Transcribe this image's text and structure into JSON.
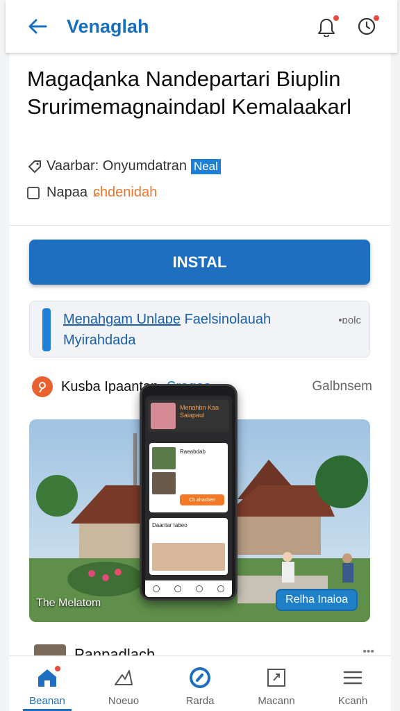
{
  "header": {
    "title": "Venaglah",
    "back_icon": "arrow-left-icon",
    "notification_icon": "bell-icon",
    "timer_icon": "clock-icon",
    "accent": "#1a6fbd"
  },
  "app": {
    "title": "Magaɖanka Nandepartari Biuplin Srurimemagnaindaɒl Kemalaakarl",
    "meta1_label": "Vaarbar: Onyumdatran",
    "meta1_tag": "Neal",
    "meta2_label": "Napaa",
    "meta2_value": "ɕhdenidah"
  },
  "install": {
    "label": "INSTAL",
    "color": "#1e6fbf"
  },
  "info_card": {
    "link1": "Menahgam Unlaɒe",
    "text1": "Faelsinolauah",
    "line2": "Myirahdada",
    "more": "•ɒolc"
  },
  "section": {
    "label": "Kusba Ipaantan",
    "link": "Sraqes",
    "right": "Galbnsem"
  },
  "hero": {
    "caption": "The Melatom",
    "chip": "Relha Inaioa",
    "phone": {
      "header_text": "Menahbn Kaa Saiapaul",
      "card_title": "Raeabdab",
      "card_button": "Ch ahacben",
      "card2_title": "Daantar Iabeo"
    }
  },
  "peek": {
    "title": "Panpadlach",
    "dots": "•••"
  },
  "bottom_nav": [
    {
      "label": "Beanan",
      "icon": "home-icon",
      "active": true
    },
    {
      "label": "Noeuo",
      "icon": "mountain-icon",
      "active": false
    },
    {
      "label": "Rarda",
      "icon": "compass-icon",
      "active": false
    },
    {
      "label": "Macann",
      "icon": "frame-icon",
      "active": false
    },
    {
      "label": "Kcanh",
      "icon": "menu-icon",
      "active": false
    }
  ]
}
